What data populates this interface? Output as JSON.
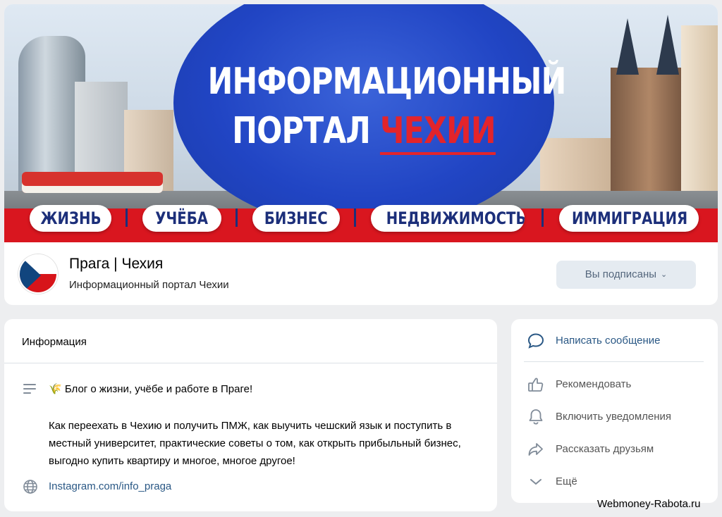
{
  "cover": {
    "title_line1": "ИНФОРМАЦИОННЫЙ",
    "title_line2_white": "ПОРТАЛ",
    "title_line2_red": "ЧЕХИИ",
    "pills": [
      "ЖИЗНЬ",
      "УЧЁБА",
      "БИЗНЕС",
      "НЕДВИЖИМОСТЬ",
      "ИММИГРАЦИЯ"
    ],
    "colors": {
      "blue": "#2145c4",
      "red": "#d9161f",
      "pill_text": "#1c2f7a"
    }
  },
  "group": {
    "name": "Прага | Чехия",
    "status": "Информационный портал Чехии",
    "subscribed_label": "Вы подписаны",
    "avatar_icon": "czech-flag-icon"
  },
  "info": {
    "title": "Информация",
    "description_line1": "🌾 Блог о жизни, учёбе и работе в Праге!",
    "description_paragraph": "Как переехать в Чехию и получить ПМЖ, как выучить чешский язык и поступить в местный университет, практические советы о том, как открыть прибыльный бизнес, выгодно купить квартиру и многое, многое другое!",
    "link": "Instagram.com/info_praga"
  },
  "actions": {
    "message": "Написать сообщение",
    "recommend": "Рекомендовать",
    "notifications": "Включить уведомления",
    "share": "Рассказать друзьям",
    "more": "Ещё"
  },
  "watermark": "Webmoney-Rabota.ru",
  "colors": {
    "page_bg": "#edeef0",
    "link": "#2a5885",
    "icon_gray": "#818c99",
    "icon_blue": "#2a5885"
  }
}
